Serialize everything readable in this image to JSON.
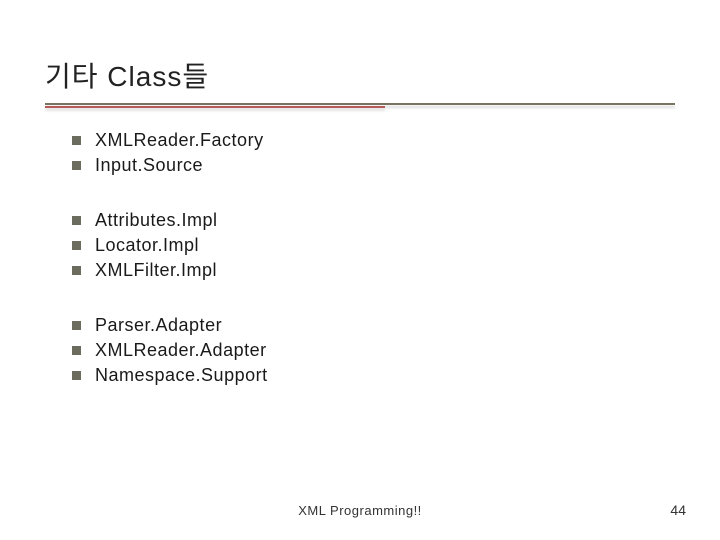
{
  "title": "기타 Class들",
  "groups": [
    {
      "items": [
        "XMLReader.Factory",
        "Input.Source"
      ]
    },
    {
      "items": [
        "Attributes.Impl",
        "Locator.Impl",
        "XMLFilter.Impl"
      ]
    },
    {
      "items": [
        "Parser.Adapter",
        "XMLReader.Adapter",
        "Namespace.Support"
      ]
    }
  ],
  "footer": "XML Programming!!",
  "page": "44"
}
